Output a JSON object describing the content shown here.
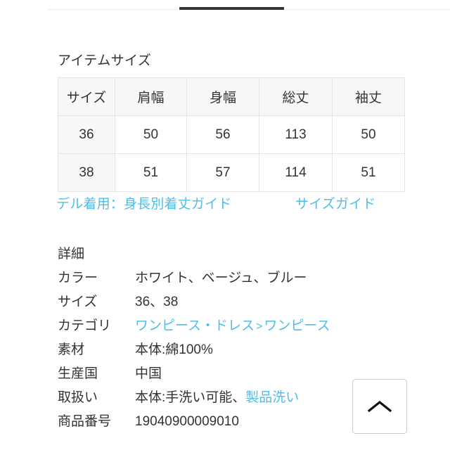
{
  "tabs": {
    "active_indicator": true,
    "indicator_color": "#333333",
    "rule_color": "#eeeeee"
  },
  "size_section": {
    "heading": "アイテムサイズ",
    "table": {
      "headers": [
        "サイズ",
        "肩幅",
        "身幅",
        "総丈",
        "袖丈"
      ],
      "rows": [
        [
          "36",
          "50",
          "56",
          "113",
          "50"
        ],
        [
          "38",
          "51",
          "57",
          "114",
          "51"
        ]
      ],
      "header_bg": "#f7f7f7",
      "border_color": "#e4e4e4"
    },
    "links": {
      "model_guide": "デル着用：身長別着丈ガイド",
      "size_guide": "サイズガイド"
    }
  },
  "detail": {
    "title": "詳細",
    "link_color": "#4fbdeb",
    "rows": [
      {
        "label": "カラー",
        "value": "ホワイト、ベージュ、ブルー"
      },
      {
        "label": "サイズ",
        "value": "36、38"
      },
      {
        "label": "カテゴリ",
        "value": "",
        "category": {
          "parent": "ワンピース・ドレス",
          "separator": ">",
          "child": "ワンピース"
        }
      },
      {
        "label": "素材",
        "value": "本体:綿100%"
      },
      {
        "label": "生産国",
        "value": "中国"
      },
      {
        "label": "取扱い",
        "value": "本体:手洗い可能、",
        "link": "製品洗い"
      },
      {
        "label": "商品番号",
        "value": "19040900009010"
      }
    ]
  },
  "scroll_top_button": {
    "icon": "chevron-up-icon",
    "label": ""
  }
}
